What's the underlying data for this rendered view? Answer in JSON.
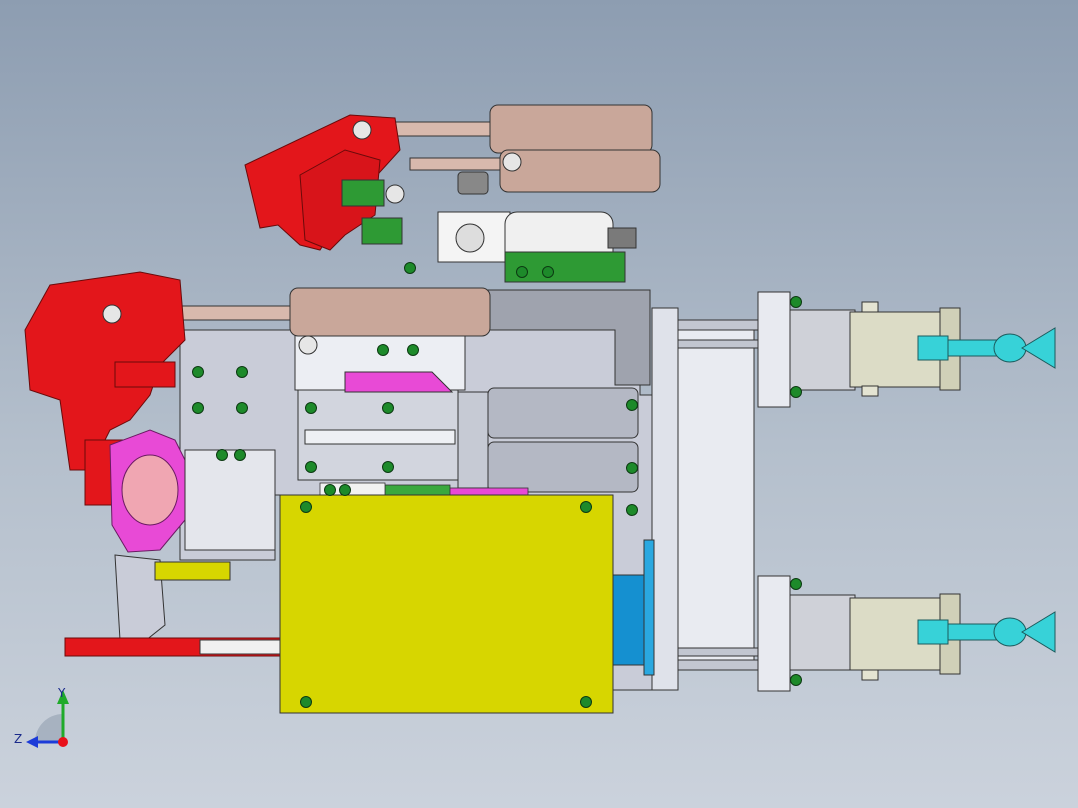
{
  "viewport": {
    "background_top": "#8d9db1",
    "background_bottom": "#cbd2dc"
  },
  "triad": {
    "y_label": "Y",
    "z_label": "Z",
    "y_color": "#1faa2a",
    "z_color": "#1c3bd8",
    "x_color": "#e8101a"
  },
  "colors": {
    "clamp_red": "#e3161b",
    "cylinder_tan": "#c9a79a",
    "plate_yellow": "#d7d600",
    "fixture_magenta": "#e84ad6",
    "base_gray": "#c9ccd8",
    "flange_light": "#dfe2ea",
    "fitting_cyan": "#37d2d8",
    "bolt_green": "#1d8a2a",
    "block_green": "#2e9a34",
    "accent_blue": "#1590d0",
    "motor_beige": "#dcdcc6"
  }
}
